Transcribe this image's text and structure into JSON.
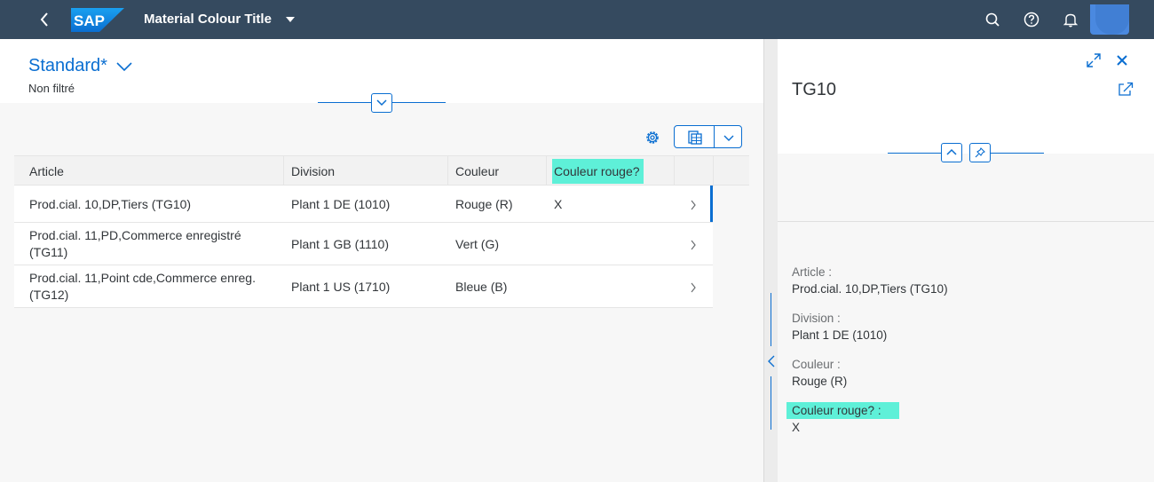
{
  "shell": {
    "title": "Material Colour Title",
    "logo_text": "SAP",
    "icons": [
      "back-icon",
      "search-icon",
      "help-icon",
      "notification-icon"
    ]
  },
  "header": {
    "variant": "Standard*",
    "filter_status": "Non filtré"
  },
  "table": {
    "columns": [
      "Article",
      "Division",
      "Couleur",
      "Couleur rouge?"
    ],
    "rows": [
      {
        "article_l1": "Prod.cial. 10,DP,Tiers (TG10)",
        "article_l2": "",
        "division": "Plant 1 DE (1010)",
        "couleur": "Rouge (R)",
        "rouge": "X",
        "selected": true
      },
      {
        "article_l1": "Prod.cial. 11,PD,Commerce enregistré",
        "article_l2": "(TG11)",
        "division": "Plant 1 GB (1110)",
        "couleur": "Vert (G)",
        "rouge": "",
        "selected": false
      },
      {
        "article_l1": "Prod.cial. 11,Point cde,Commerce enreg.",
        "article_l2": "(TG12)",
        "division": "Plant 1 US (1710)",
        "couleur": "Bleue (B)",
        "rouge": "",
        "selected": false
      }
    ]
  },
  "detail": {
    "title": "TG10",
    "fields": [
      {
        "label": "Article :",
        "value": "Prod.cial. 10,DP,Tiers (TG10)"
      },
      {
        "label": "Division :",
        "value": "Plant 1 DE (1010)"
      },
      {
        "label": "Couleur :",
        "value": "Rouge (R)"
      },
      {
        "label": "Couleur rouge? :",
        "value": "X"
      }
    ]
  },
  "colors": {
    "shell": "#354a5f",
    "accent": "#0a6ed1",
    "highlight": "#5ef0d8"
  }
}
